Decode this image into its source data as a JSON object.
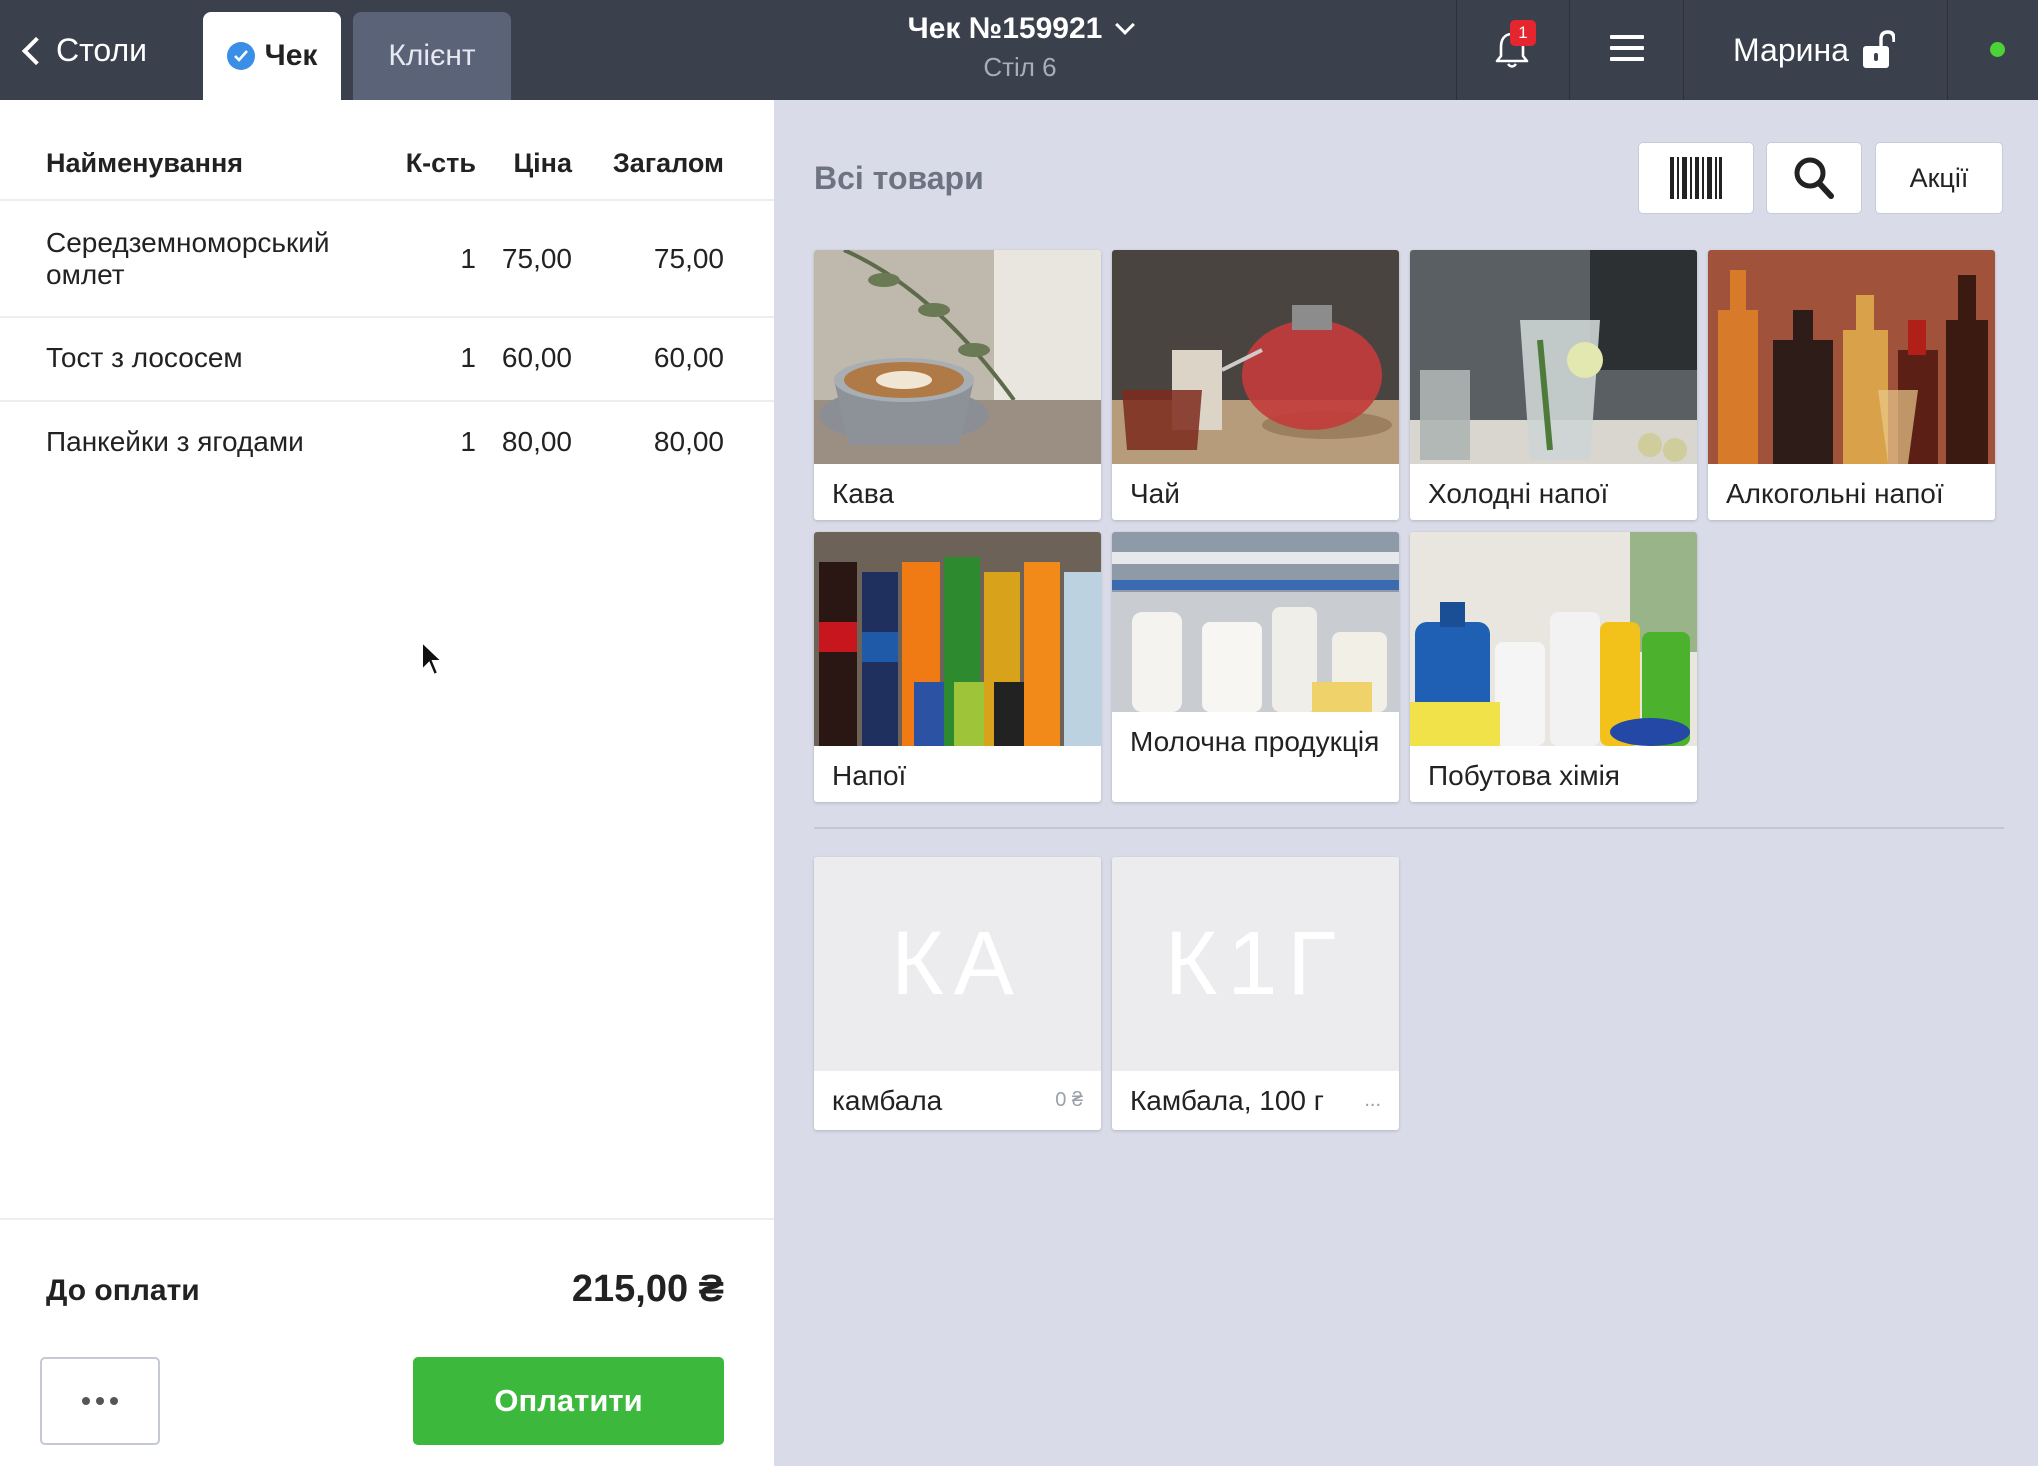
{
  "topbar": {
    "back_label": "Столи",
    "tab_check": "Чек",
    "tab_client": "Клієнт",
    "receipt_title": "Чек №159921",
    "table_label": "Стіл 6",
    "notification_count": "1",
    "user_name": "Марина",
    "online_color": "#4cd137"
  },
  "order": {
    "columns": {
      "name": "Найменування",
      "qty": "К-сть",
      "price": "Ціна",
      "total": "Загалом"
    },
    "items": [
      {
        "name": "Середземноморський омлет",
        "qty": "1",
        "price": "75,00",
        "total": "75,00"
      },
      {
        "name": "Тост з лососем",
        "qty": "1",
        "price": "60,00",
        "total": "60,00"
      },
      {
        "name": "Панкейки з ягодами",
        "qty": "1",
        "price": "80,00",
        "total": "80,00"
      }
    ],
    "to_pay_label": "До оплати",
    "to_pay_value": "215,00 ₴",
    "pay_button": "Оплатити"
  },
  "catalog": {
    "title": "Всі товари",
    "promo_button": "Акції",
    "categories": [
      {
        "label": "Кава",
        "icon": "coffee-image"
      },
      {
        "label": "Чай",
        "icon": "tea-image"
      },
      {
        "label": "Холодні напої",
        "icon": "cold-drinks-image"
      },
      {
        "label": "Алкогольні напої",
        "icon": "alcohol-image"
      },
      {
        "label": "Напої",
        "icon": "soft-drinks-image"
      },
      {
        "label": "Молочна продукція",
        "icon": "dairy-image"
      },
      {
        "label": "Побутова хімія",
        "icon": "household-chemicals-image"
      }
    ],
    "products": [
      {
        "initials": "КА",
        "label": "камбала",
        "price": "0 ₴"
      },
      {
        "initials": "К1Г",
        "label": "Камбала, 100 г",
        "price": "..."
      }
    ]
  },
  "colors": {
    "accent_green": "#3cb93c",
    "header_bg": "#3a404c",
    "panel_bg": "#d9dce8"
  }
}
